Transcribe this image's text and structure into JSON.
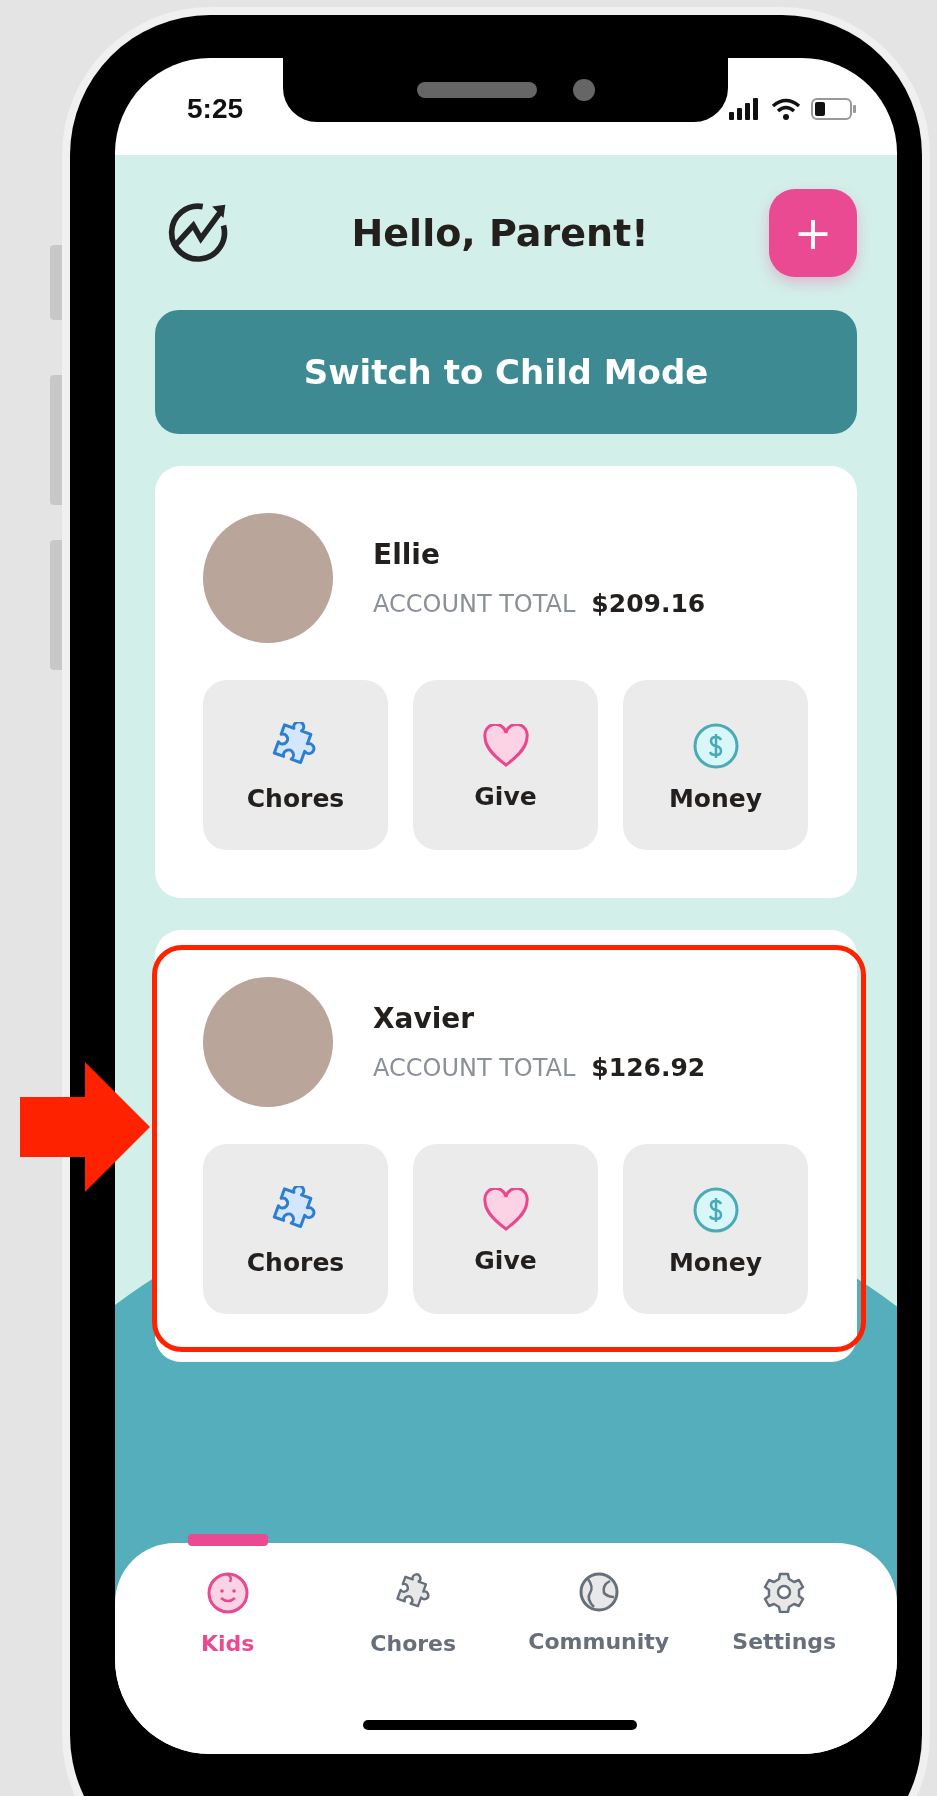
{
  "status_bar": {
    "time": "5:25"
  },
  "header": {
    "title": "Hello, Parent!",
    "add_button": "+"
  },
  "switch_button": "Switch to Child Mode",
  "kids": [
    {
      "name": "Ellie",
      "account_label": "ACCOUNT TOTAL",
      "total": "$209.16",
      "highlighted": false,
      "actions": [
        {
          "label": "Chores",
          "kind": "chores"
        },
        {
          "label": "Give",
          "kind": "give"
        },
        {
          "label": "Money",
          "kind": "money"
        }
      ]
    },
    {
      "name": "Xavier",
      "account_label": "ACCOUNT TOTAL",
      "total": "$126.92",
      "highlighted": true,
      "actions": [
        {
          "label": "Chores",
          "kind": "chores"
        },
        {
          "label": "Give",
          "kind": "give"
        },
        {
          "label": "Money",
          "kind": "money"
        }
      ]
    }
  ],
  "nav": [
    {
      "label": "Kids",
      "kind": "kids",
      "selected": true
    },
    {
      "label": "Chores",
      "kind": "chores",
      "selected": false
    },
    {
      "label": "Community",
      "kind": "community",
      "selected": false
    },
    {
      "label": "Settings",
      "kind": "settings",
      "selected": false
    }
  ]
}
